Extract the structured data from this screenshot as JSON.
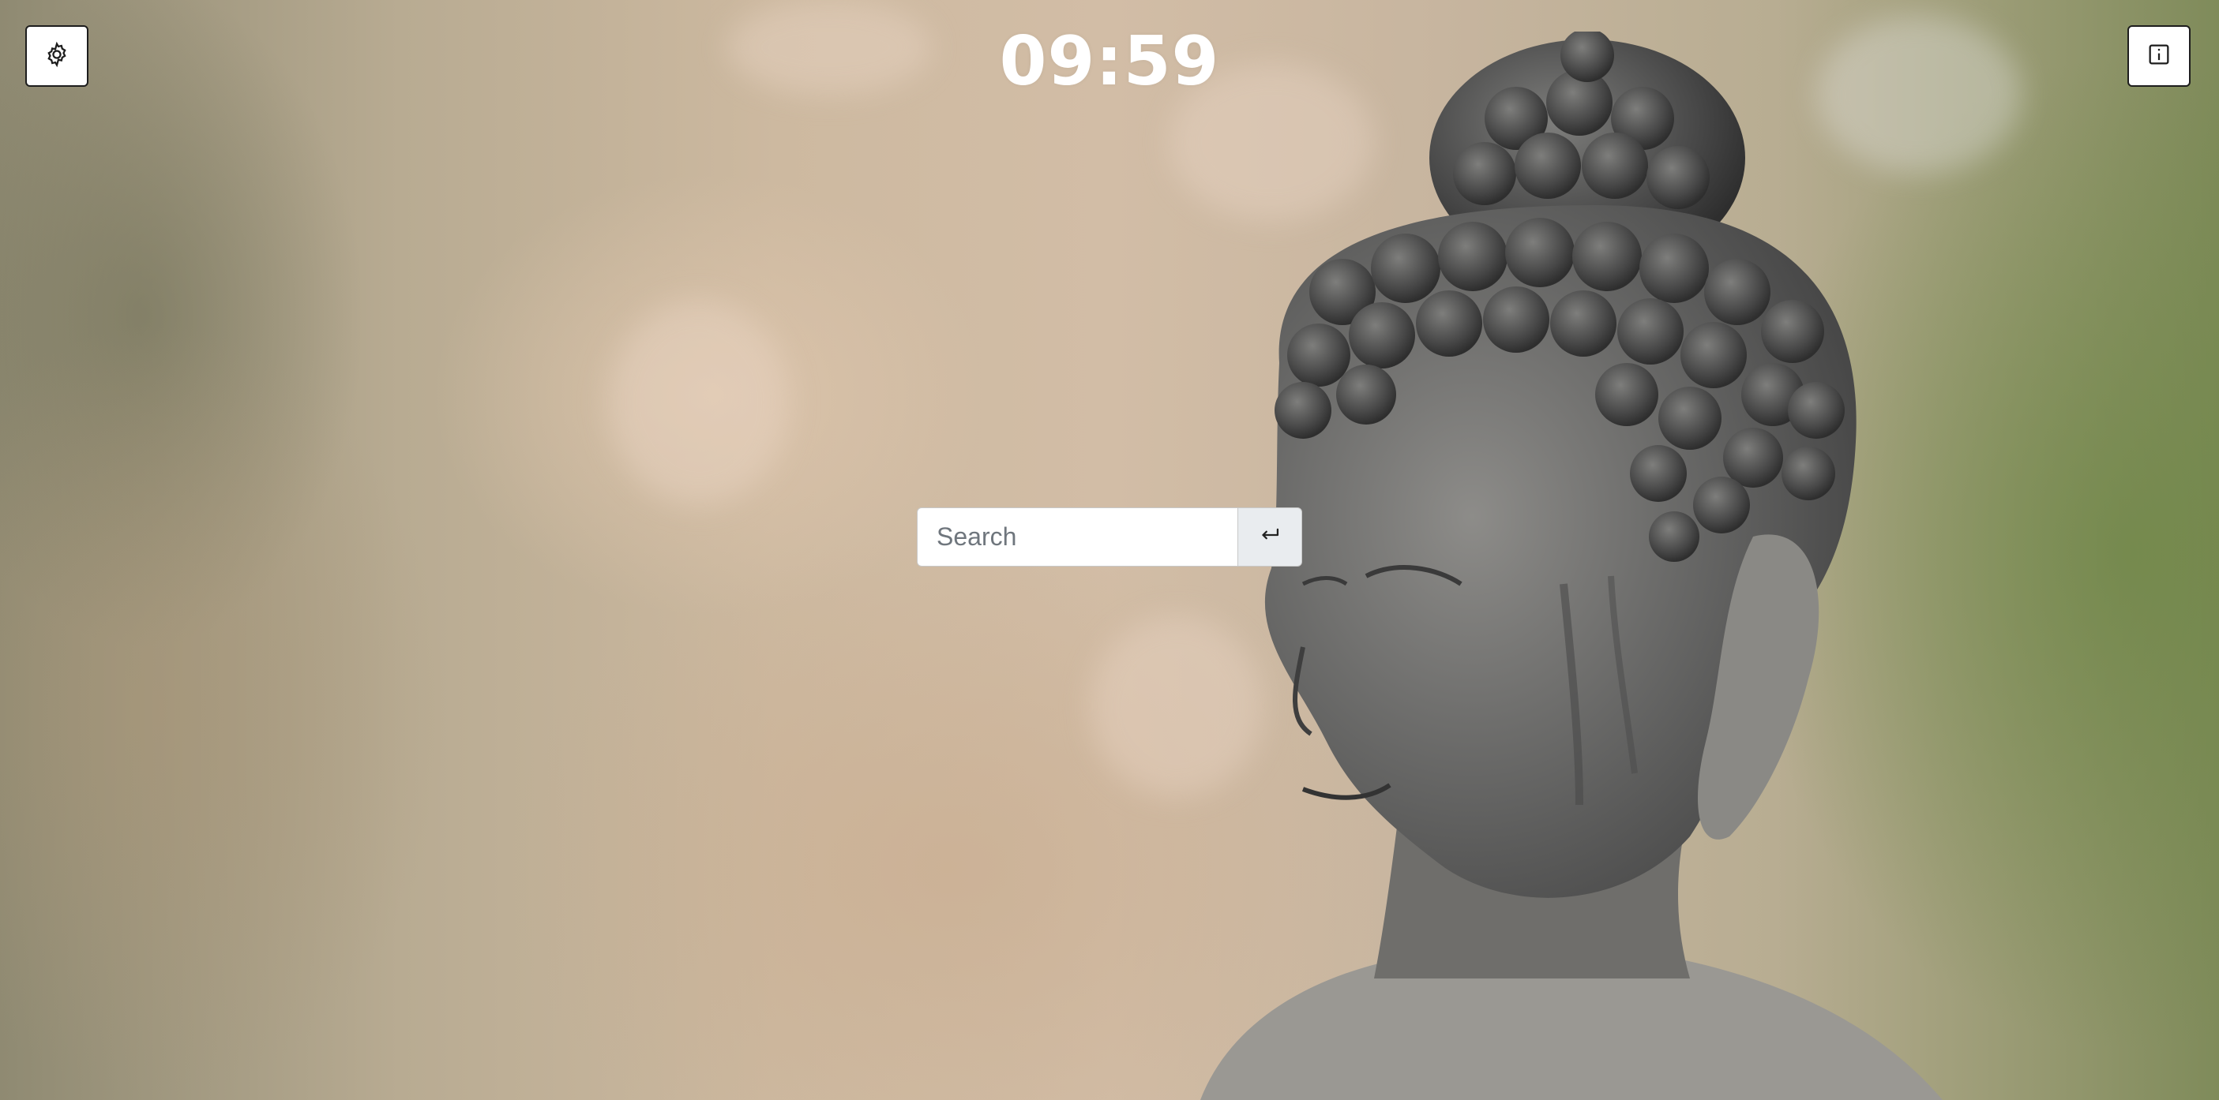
{
  "clock": {
    "time": "09:59"
  },
  "search": {
    "placeholder": "Search",
    "value": ""
  },
  "toolbar": {
    "settings_icon": "gear-icon",
    "info_icon": "info-icon",
    "submit_icon": "enter-return-icon"
  },
  "background": {
    "subject": "stone-buddha-statue-photo"
  }
}
